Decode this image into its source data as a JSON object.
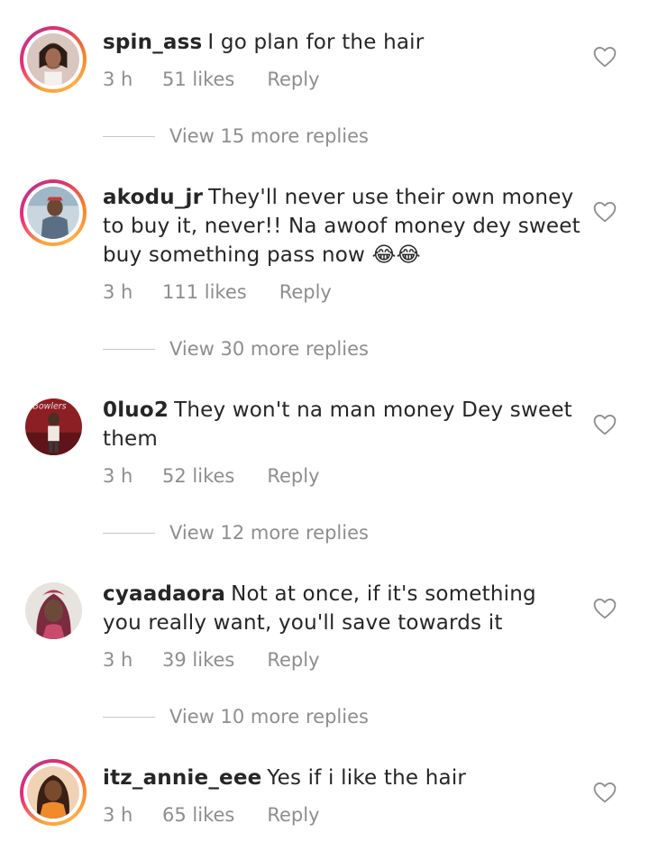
{
  "comments": [
    {
      "username": "spin_ass",
      "text": "I go plan for the hair",
      "time": "3 h",
      "likes": "51 likes",
      "reply": "Reply",
      "view_replies": "View 15 more replies"
    },
    {
      "username": "akodu_jr",
      "text": "They'll never use their own money to buy it, never!! Na awoof money dey sweet buy something pass now 😂😂",
      "time": "3 h",
      "likes": "111 likes",
      "reply": "Reply",
      "view_replies": "View 30 more replies"
    },
    {
      "username": "0luo2",
      "text": "They won't na man money Dey sweet them",
      "time": "3 h",
      "likes": "52 likes",
      "reply": "Reply",
      "view_replies": "View 12 more replies"
    },
    {
      "username": "cyaadaora",
      "text": "Not at once, if it's something you really want, you'll save towards it",
      "time": "3 h",
      "likes": "39 likes",
      "reply": "Reply",
      "view_replies": "View 10 more replies"
    },
    {
      "username": "itz_annie_eee",
      "text": "Yes if i like the hair",
      "time": "3 h",
      "likes": "65 likes",
      "reply": "Reply"
    }
  ],
  "icons": {
    "like": "heart-outline-icon"
  }
}
